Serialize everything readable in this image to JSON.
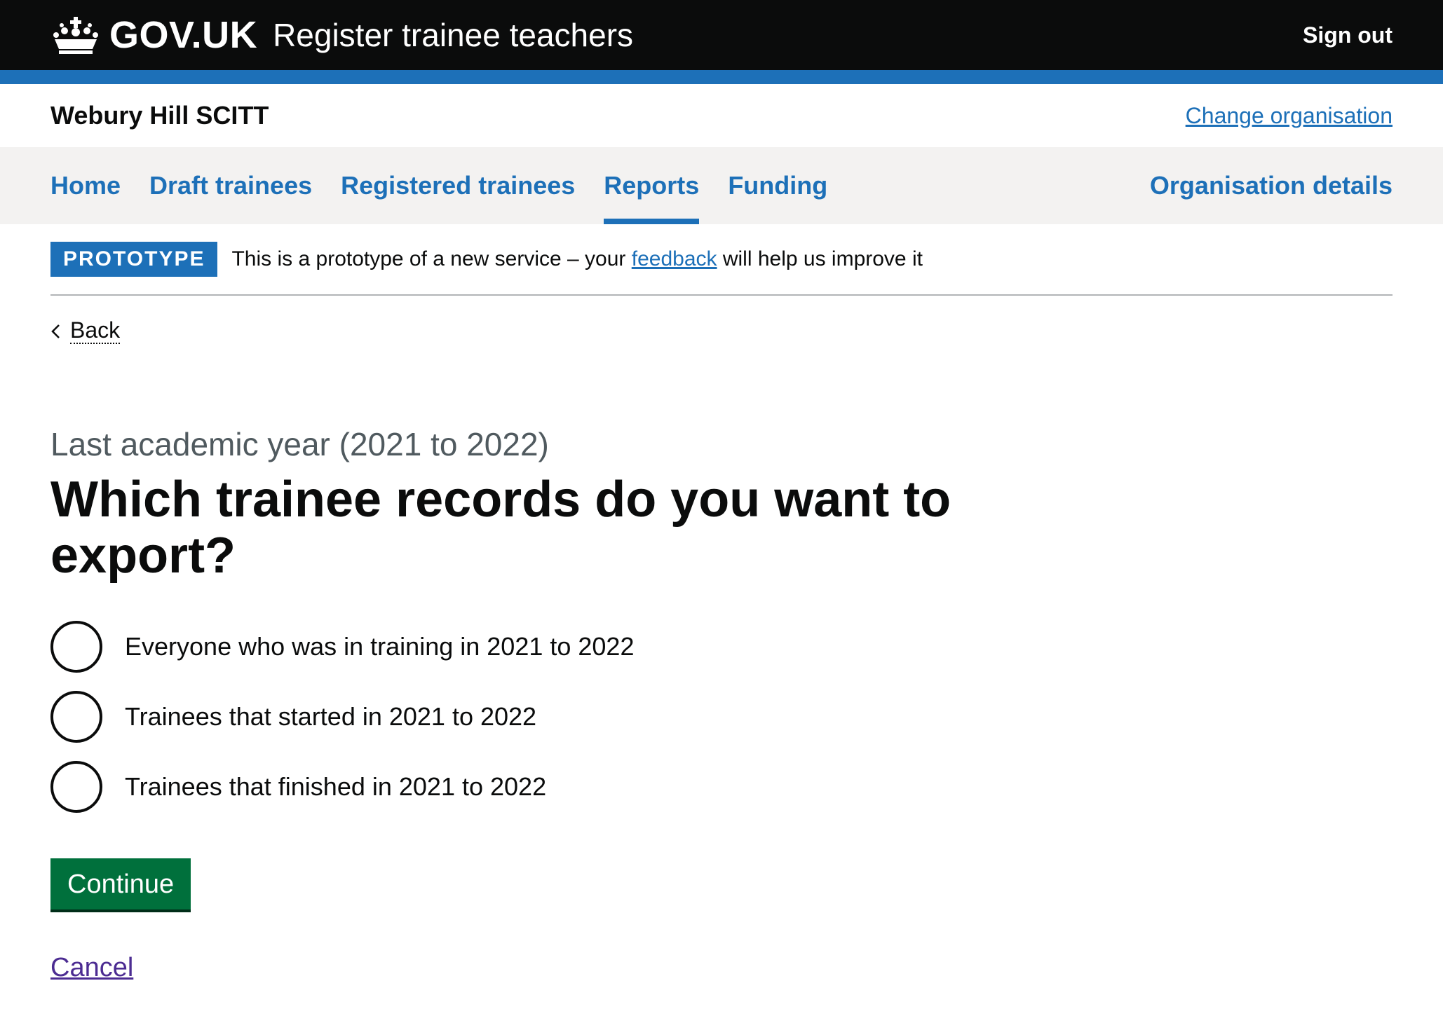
{
  "header": {
    "logo_text": "GOV.UK",
    "service_name": "Register trainee teachers",
    "sign_out": "Sign out"
  },
  "organisation": {
    "name": "Webury Hill SCITT",
    "change_link": "Change organisation"
  },
  "nav": {
    "items": [
      {
        "label": "Home"
      },
      {
        "label": "Draft trainees"
      },
      {
        "label": "Registered trainees"
      },
      {
        "label": "Reports"
      },
      {
        "label": "Funding"
      }
    ],
    "active": "Reports",
    "right_item": "Organisation details"
  },
  "phase_banner": {
    "tag": "PROTOTYPE",
    "text_before": "This is a prototype of a new service – your ",
    "link": "feedback",
    "text_after": " will help us improve it"
  },
  "back_link": "Back",
  "page": {
    "caption": "Last academic year (2021 to 2022)",
    "title": "Which trainee records do you want to export?"
  },
  "options": [
    "Everyone who was in training in 2021 to 2022",
    "Trainees that started in 2021 to 2022",
    "Trainees that finished in 2021 to 2022"
  ],
  "continue_button": "Continue",
  "cancel_link": "Cancel",
  "colors": {
    "header_bg": "#0b0c0c",
    "brand_blue": "#1d70b8",
    "button_green": "#00703c",
    "visited_link": "#4c2c92",
    "nav_bg": "#f3f2f1"
  }
}
